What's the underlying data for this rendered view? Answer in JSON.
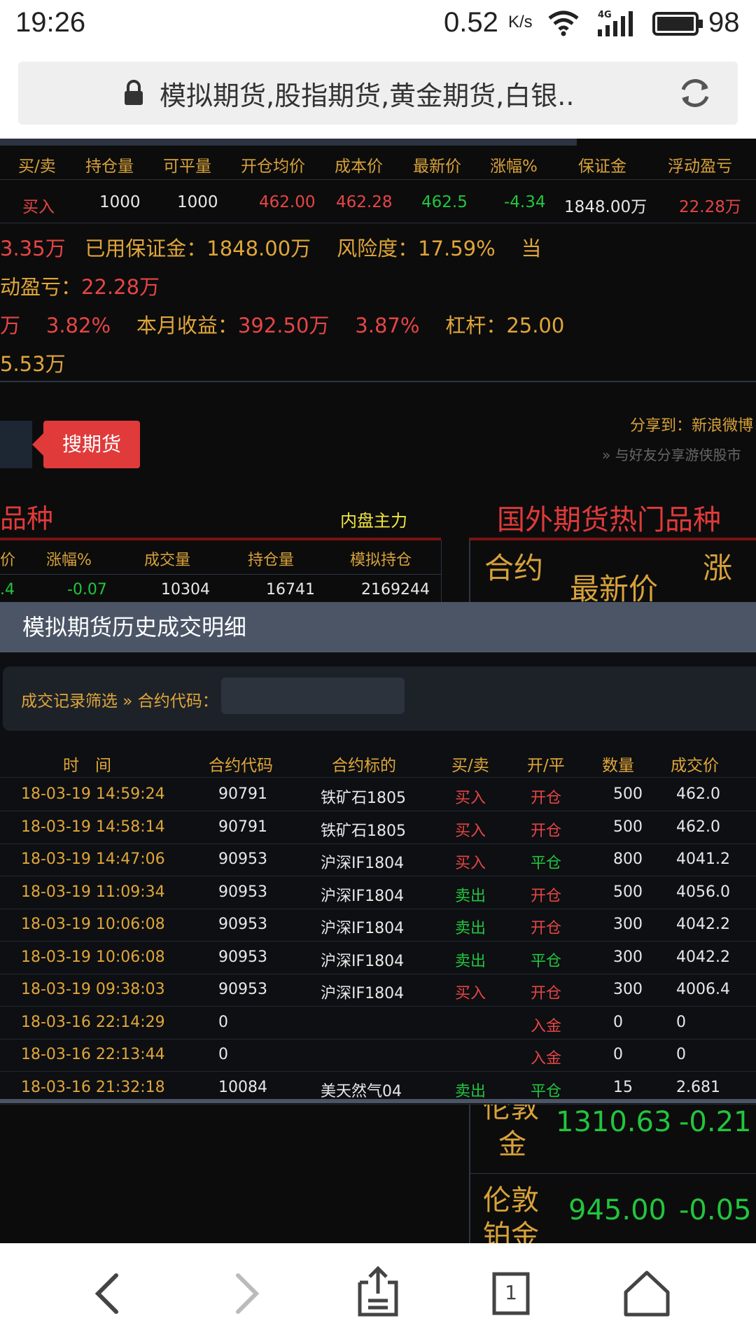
{
  "status": {
    "time": "19:26",
    "speed": "0.52",
    "speed_unit": "K/s",
    "network": "4G",
    "battery": "98"
  },
  "browser": {
    "title": "模拟期货,股指期货,黄金期货,白银.."
  },
  "positions": {
    "headers": [
      "买/卖",
      "持仓量",
      "可平量",
      "开仓均价",
      "成本价",
      "最新价",
      "涨幅%",
      "保证金",
      "浮动盈亏"
    ],
    "row": [
      "买入",
      "1000",
      "1000",
      "462.00",
      "462.28",
      "462.5",
      "-4.34",
      "1848.00万",
      "22.28万"
    ]
  },
  "summary": {
    "l1a": "3.35万",
    "l1b_label": "已用保证金：",
    "l1b_value": "1848.00万",
    "l1c_label": "风险度：",
    "l1c_value": "17.59%",
    "l1d": "当",
    "l2_label": "动盈亏：",
    "l2_value": "22.28万",
    "l3a": "万",
    "l3b": "3.82%",
    "l3c_label": "本月收益：",
    "l3c_value": "392.50万",
    "l3d": "3.87%",
    "l3e_label": "杠杆：",
    "l3e_value": "25.00",
    "l4": "5.53万"
  },
  "share": {
    "label": "分享到：新浪微博",
    "sub": "» 与好友分享游侠股市"
  },
  "search": {
    "button": "搜期货"
  },
  "domestic": {
    "title": "品种",
    "tag": "内盘主力",
    "headers": [
      "价",
      "涨幅%",
      "成交量",
      "持仓量",
      "模拟持仓"
    ],
    "row": [
      ".4",
      "-0.07",
      "10304",
      "16741",
      "2169244"
    ]
  },
  "foreign": {
    "title": "国外期货热门品种",
    "headers": [
      "合约",
      "最新价",
      "涨"
    ],
    "rows": [
      {
        "name_top": "伦敦",
        "name_bottom": "金",
        "price": "1310.63",
        "change": "-0.21"
      },
      {
        "name_top": "伦敦",
        "name_bottom": "铂金",
        "price": "945.00",
        "change": "-0.05"
      }
    ]
  },
  "history": {
    "title": "模拟期货历史成交明细",
    "filter_label": "成交记录筛选 » 合约代码：",
    "filter_value": "",
    "headers": [
      "时　间",
      "合约代码",
      "合约标的",
      "买/卖",
      "开/平",
      "数量",
      "成交价"
    ],
    "rows": [
      [
        "18-03-19 14:59:24",
        "90791",
        "铁矿石1805",
        "买入",
        "开仓",
        "500",
        "462.0"
      ],
      [
        "18-03-19 14:58:14",
        "90791",
        "铁矿石1805",
        "买入",
        "开仓",
        "500",
        "462.0"
      ],
      [
        "18-03-19 14:47:06",
        "90953",
        "沪深IF1804",
        "买入",
        "平仓",
        "800",
        "4041.2"
      ],
      [
        "18-03-19 11:09:34",
        "90953",
        "沪深IF1804",
        "卖出",
        "开仓",
        "500",
        "4056.0"
      ],
      [
        "18-03-19 10:06:08",
        "90953",
        "沪深IF1804",
        "卖出",
        "开仓",
        "300",
        "4042.2"
      ],
      [
        "18-03-19 10:06:08",
        "90953",
        "沪深IF1804",
        "卖出",
        "平仓",
        "300",
        "4042.2"
      ],
      [
        "18-03-19 09:38:03",
        "90953",
        "沪深IF1804",
        "买入",
        "开仓",
        "300",
        "4006.4"
      ],
      [
        "18-03-16 22:14:29",
        "0",
        "",
        "",
        "入金",
        "0",
        "0"
      ],
      [
        "18-03-16 22:13:44",
        "0",
        "",
        "",
        "入金",
        "0",
        "0"
      ],
      [
        "18-03-16 21:32:18",
        "10084",
        "美天然气04",
        "卖出",
        "平仓",
        "15",
        "2.681"
      ]
    ]
  },
  "nav": {
    "tabs_count": "1"
  },
  "colors": {
    "red": "#e64545",
    "green": "#22c53e",
    "orange": "#e0a63a",
    "panel": "#4b5566"
  }
}
